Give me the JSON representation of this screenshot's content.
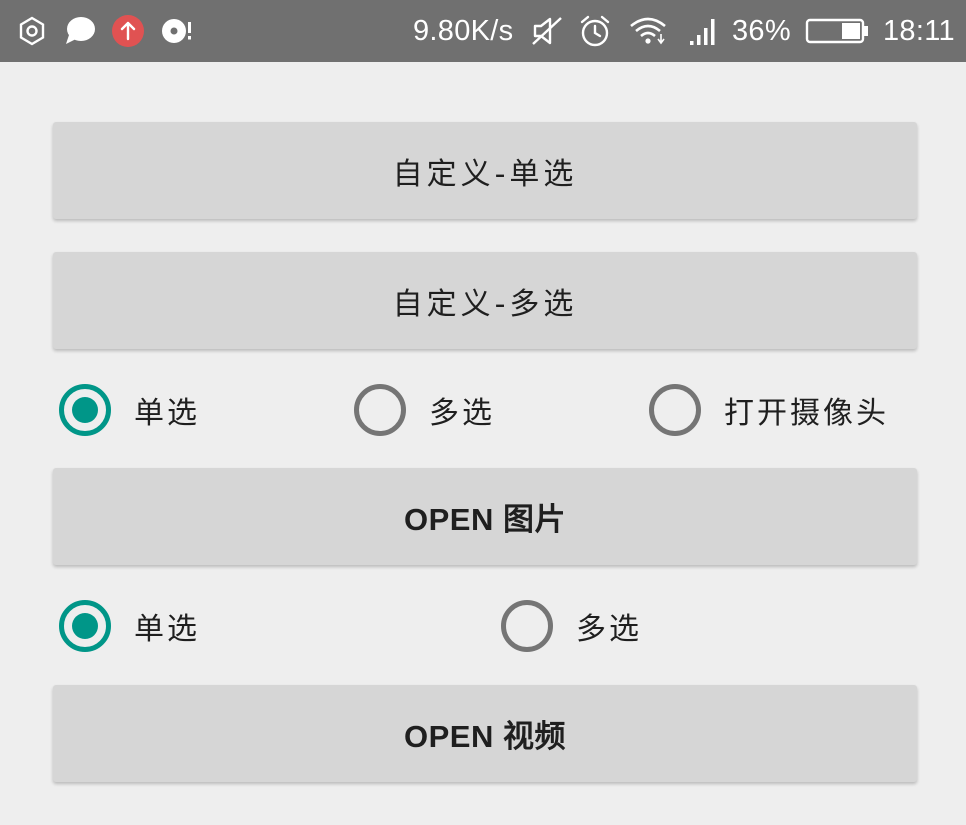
{
  "status_bar": {
    "network_speed": "9.80K/s",
    "battery_percent": "36%",
    "time": "18:11",
    "battery_level": 0.36,
    "icons": [
      "settings-hex-icon",
      "chat-bubble-icon",
      "upload-icon",
      "media-icon",
      "mute-icon",
      "alarm-icon",
      "wifi-icon",
      "signal-icon",
      "battery-icon"
    ]
  },
  "buttons": {
    "custom_single": "自定义-单选",
    "custom_multi": "自定义-多选",
    "open_image": "OPEN 图片",
    "open_video": "OPEN 视频"
  },
  "image_options": {
    "single": "单选",
    "multi": "多选",
    "camera": "打开摄像头",
    "selected": "single"
  },
  "video_options": {
    "single": "单选",
    "multi": "多选",
    "selected": "single"
  },
  "colors": {
    "accent": "#009688",
    "radio_unchecked": "#757575",
    "button_bg": "#d6d6d6",
    "page_bg": "#eeeeee",
    "status_bar_bg": "#707070",
    "upload_badge": "#e05252"
  }
}
